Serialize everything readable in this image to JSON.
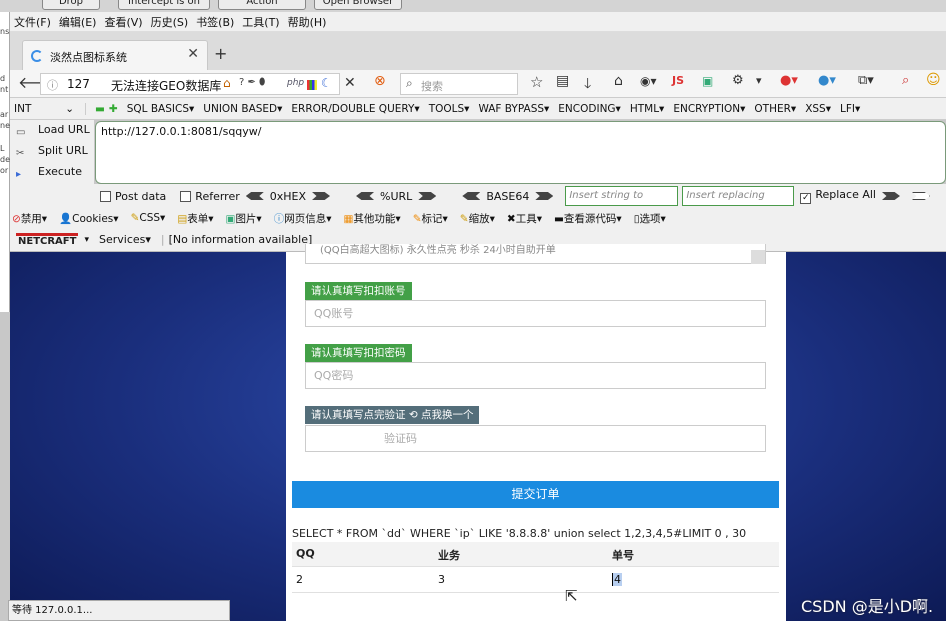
{
  "burp": {
    "buttons": [
      "Drop",
      "Intercept is on",
      "Action",
      "Open Browser"
    ]
  },
  "left_fragments": [
    "ns",
    "d",
    "nt",
    "ar",
    "ne",
    "L",
    "de",
    "or"
  ],
  "menubar": [
    "文件(F)",
    "编辑(E)",
    "查看(V)",
    "历史(S)",
    "书签(B)",
    "工具(T)",
    "帮助(H)"
  ],
  "tab": {
    "title": "淡然点图标系统"
  },
  "nav": {
    "url_prefix": "127",
    "page_title": "无法连接GEO数据库",
    "search_placeholder": "搜索"
  },
  "hackbar": {
    "select_value": "INT",
    "menu": [
      "SQL BASICS▾",
      "UNION BASED▾",
      "ERROR/DOUBLE QUERY▾",
      "TOOLS▾",
      "WAF BYPASS▾",
      "ENCODING▾",
      "HTML▾",
      "ENCRYPTION▾",
      "OTHER▾",
      "XSS▾",
      "LFI▾"
    ],
    "load_url": "Load URL",
    "split_url": "Split URL",
    "execute": "Execute",
    "url_value": "http://127.0.0.1:8081/sqqyw/",
    "post_data": "Post data",
    "referrer": "Referrer",
    "hex": "0xHEX",
    "url_enc": "%URL",
    "base64": "BASE64",
    "insert_placeholder": "Insert string to replace",
    "replacing_placeholder": "Insert replacing string",
    "replace_all": "Replace All"
  },
  "webdev": [
    "禁用▾",
    "Cookies▾",
    "CSS▾",
    "表单▾",
    "图片▾",
    "网页信息▾",
    "其他功能▾",
    "标记▾",
    "缩放▾",
    "工具▾",
    "查看源代码▾",
    "选项▾"
  ],
  "netcraft": {
    "logo": "NETCRAFT",
    "services": "Services▾",
    "info": "[No information available]"
  },
  "form": {
    "top_field_text": "(QQ白高超大图标) 永久性点亮 秒杀 24小时自助开单",
    "qq_label": "请认真填写扣扣账号",
    "qq_placeholder": "QQ账号",
    "pwd_label": "请认真填写扣扣密码",
    "pwd_placeholder": "QQ密码",
    "captcha_label": "请认真填写点完验证 ⟲ 点我换一个",
    "captcha_placeholder": "验证码",
    "submit": "提交订单"
  },
  "result": {
    "sql": "SELECT * FROM `dd` WHERE `ip` LIKE '8.8.8.8' union select 1,2,3,4,5#LIMIT 0 , 30",
    "headers": [
      "QQ",
      "业务",
      "单号"
    ],
    "row": [
      "2",
      "3",
      "4"
    ]
  },
  "status": "等待 127.0.0.1...",
  "watermark": "CSDN @是小D啊."
}
